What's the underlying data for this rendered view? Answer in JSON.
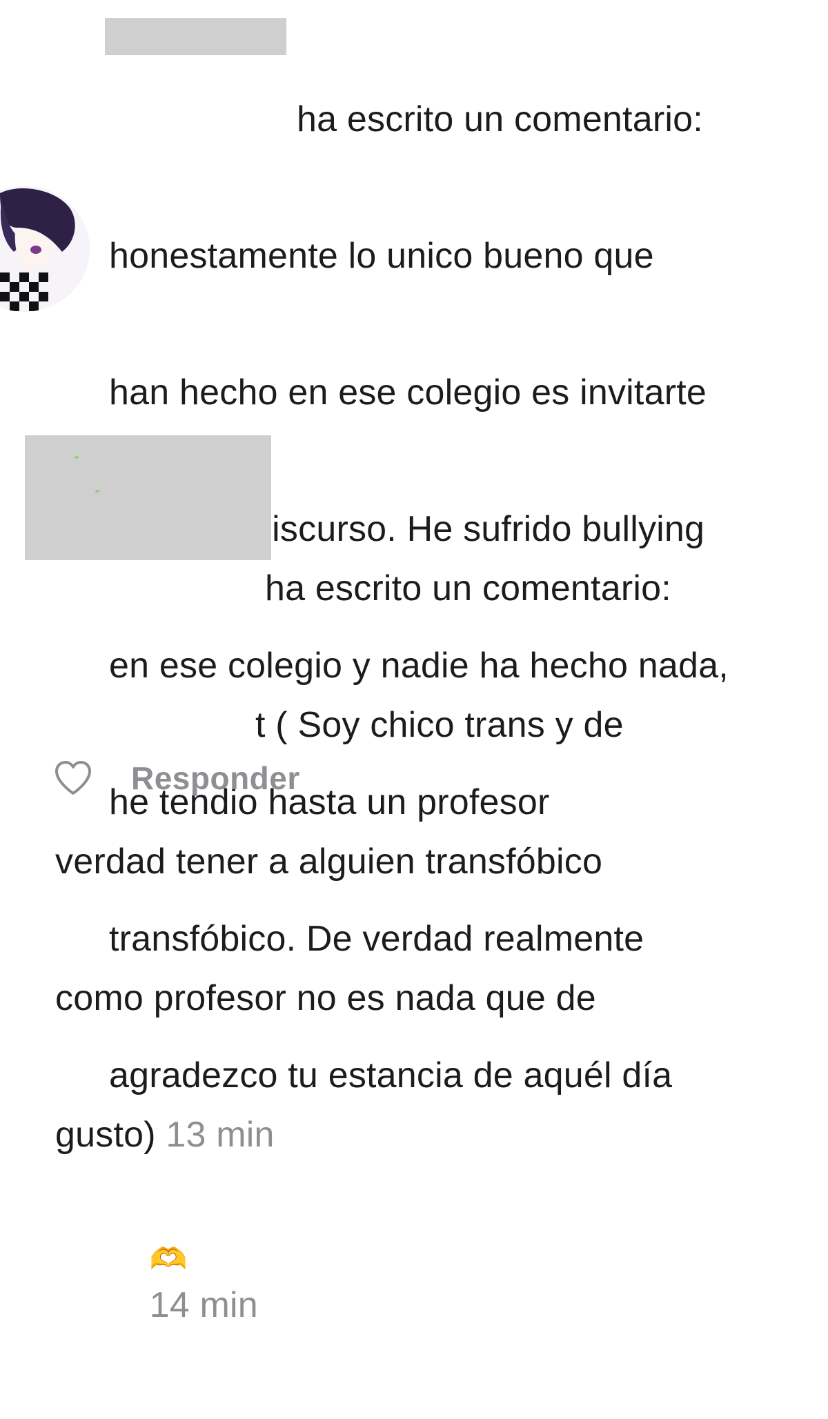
{
  "comment1": {
    "header": "ha escrito un comentario:",
    "lines": [
      "honestamente lo unico bueno que",
      "han hecho en ese colegio es invitarte",
      "a dar un discurso. He sufrido bullying",
      "en ese colegio y nadie ha hecho nada,",
      "he tendio hasta un profesor",
      "transfóbico. De verdad realmente",
      "agradezco tu estancia de aquél día"
    ],
    "emoji": "🫶",
    "time": "14 min"
  },
  "comment2": {
    "header": "ha escrito un comentario:",
    "mention_fragment": "t",
    "line1_rest": " ( Soy chico trans y de",
    "lines": [
      "verdad tener a alguien transfóbico",
      "como profesor no es nada que de"
    ],
    "last_line": "gusto)",
    "time": "13 min"
  },
  "actions": {
    "reply_label": "Responder",
    "like_icon": "heart-outline-icon"
  },
  "colors": {
    "text": "#1c1c1e",
    "meta": "#8e8e93",
    "redaction": "#cfcfcf"
  }
}
